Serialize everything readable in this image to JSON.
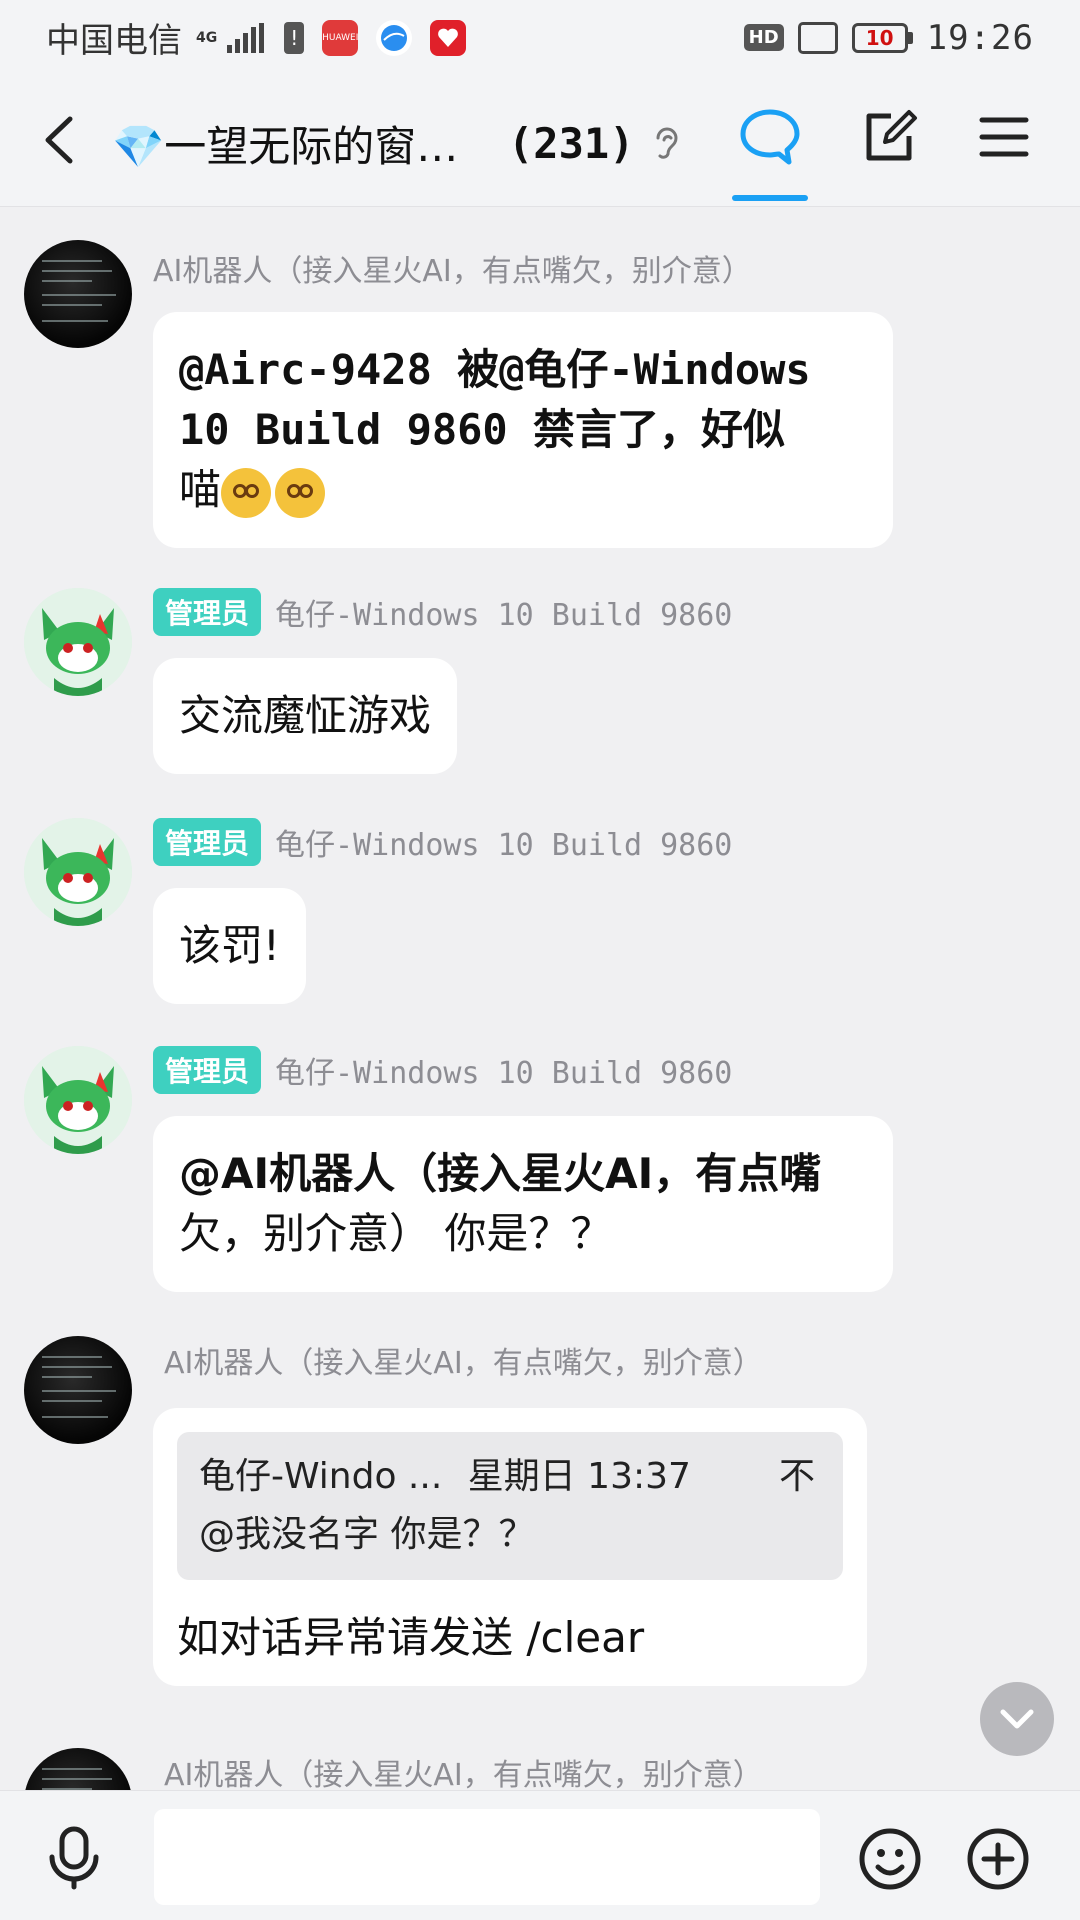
{
  "status_bar": {
    "carrier": "中国电信",
    "network": "4G",
    "hd_label": "HD",
    "battery": "10",
    "time": "19:26",
    "app_icons": [
      "huawei-app-icon",
      "browser-app-icon",
      "red-app-icon"
    ],
    "huawei_label": "HUAWEI"
  },
  "header": {
    "title": "💎一望无际的窗边…",
    "count": "(231)"
  },
  "messages": [
    {
      "sender": "AI机器人（接入星火AI，有点嘴欠，别介意）",
      "avatar": "ai-robot-avatar",
      "line1": "@Airc-9428 被@龟仔-Windows",
      "line2": "10 Build 9860 禁言了，好似",
      "line3": "喵"
    },
    {
      "badge": "管理员",
      "sender": "龟仔-Windows 10 Build 9860",
      "text": "交流魔怔游戏"
    },
    {
      "badge": "管理员",
      "sender": "龟仔-Windows 10 Build 9860",
      "text": "该罚!"
    },
    {
      "badge": "管理员",
      "sender": "龟仔-Windows 10 Build 9860",
      "line1": "@AI机器人（接入星火AI，有点嘴",
      "line2": "欠，别介意） 你是？？"
    },
    {
      "sender": "AI机器人（接入星火AI，有点嘴欠，别介意）",
      "quote_author": "龟仔-Windo ...",
      "quote_time": "星期日 13:37",
      "quote_text": "@我没名字  你是？？",
      "text": "如对话异常请发送 /clear"
    },
    {
      "sender": "AI机器人（接入星火AI，有点嘴欠，别介意）"
    }
  ],
  "colors": {
    "accent": "#1aa0f4",
    "admin_badge": "#3ed0c0",
    "background": "#f0f0f2",
    "bubble": "#ffffff"
  }
}
